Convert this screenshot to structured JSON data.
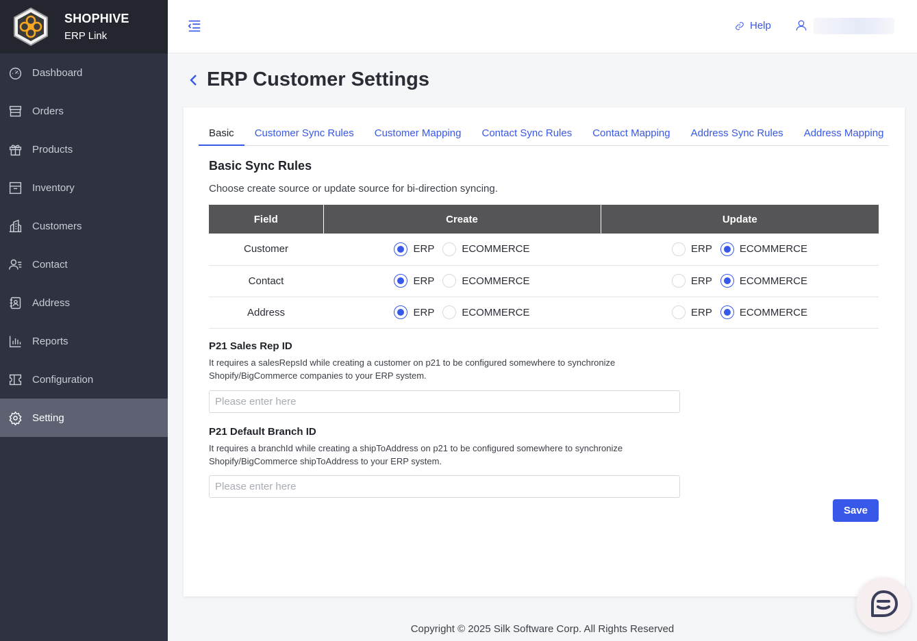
{
  "brand": {
    "name": "SHOPHIVE",
    "subtitle": "ERP Link"
  },
  "sidebar": {
    "items": [
      {
        "label": "Dashboard",
        "icon": "dashboard-icon"
      },
      {
        "label": "Orders",
        "icon": "store-icon"
      },
      {
        "label": "Products",
        "icon": "gift-icon"
      },
      {
        "label": "Inventory",
        "icon": "archive-icon"
      },
      {
        "label": "Customers",
        "icon": "building-icon"
      },
      {
        "label": "Contact",
        "icon": "contact-icon"
      },
      {
        "label": "Address",
        "icon": "address-book-icon"
      },
      {
        "label": "Reports",
        "icon": "bar-chart-icon"
      },
      {
        "label": "Configuration",
        "icon": "ticket-icon"
      },
      {
        "label": "Setting",
        "icon": "gear-icon",
        "active": true
      }
    ]
  },
  "header": {
    "help_label": "Help"
  },
  "page": {
    "title": "ERP Customer Settings"
  },
  "tabs": [
    {
      "label": "Basic",
      "active": true
    },
    {
      "label": "Customer Sync Rules"
    },
    {
      "label": "Customer Mapping"
    },
    {
      "label": "Contact Sync Rules"
    },
    {
      "label": "Contact Mapping"
    },
    {
      "label": "Address Sync Rules"
    },
    {
      "label": "Address Mapping"
    }
  ],
  "basic": {
    "title": "Basic Sync Rules",
    "description": "Choose create source or update source for bi-direction syncing.",
    "table": {
      "headers": {
        "field": "Field",
        "create": "Create",
        "update": "Update"
      },
      "option_erp": "ERP",
      "option_ecommerce": "ECOMMERCE",
      "rows": [
        {
          "field": "Customer",
          "create": "ERP",
          "update": "ECOMMERCE"
        },
        {
          "field": "Contact",
          "create": "ERP",
          "update": "ECOMMERCE"
        },
        {
          "field": "Address",
          "create": "ERP",
          "update": "ECOMMERCE"
        }
      ]
    },
    "sales_rep": {
      "label": "P21 Sales Rep ID",
      "help": "It requires a salesRepsId while creating a customer on p21 to be configured somewhere to synchronize Shopify/BigCommerce companies to your ERP system.",
      "placeholder": "Please enter here",
      "value": ""
    },
    "branch": {
      "label": "P21 Default Branch ID",
      "help": "It requires a branchId while creating a shipToAddress on p21 to be configured somewhere to synchronize Shopify/BigCommerce shipToAddress to your ERP system.",
      "placeholder": "Please enter here",
      "value": ""
    },
    "save_label": "Save"
  },
  "footer": {
    "copyright": "Copyright © 2025 Silk Software Corp. All Rights Reserved"
  },
  "colors": {
    "accent": "#3858e9",
    "sidebar": "#2f3241",
    "sidebar_active": "#5d6172",
    "table_header": "#555558"
  }
}
